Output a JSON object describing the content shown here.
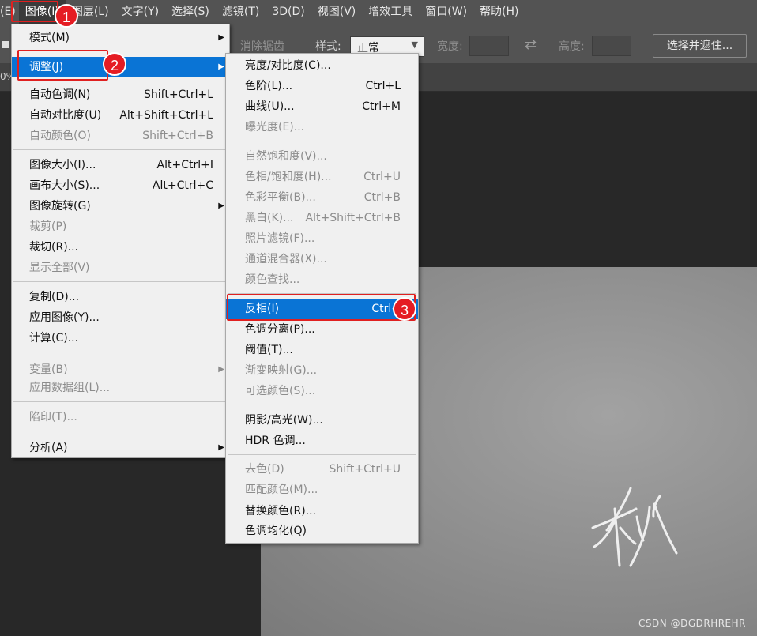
{
  "menubar": {
    "items": [
      "(E)",
      "图像(I)",
      "图层(L)",
      "文字(Y)",
      "选择(S)",
      "滤镜(T)",
      "3D(D)",
      "视图(V)",
      "增效工具",
      "窗口(W)",
      "帮助(H)"
    ]
  },
  "options": {
    "antialias": "消除锯齿",
    "style_label": "样式:",
    "style_value": "正常",
    "width_label": "宽度:",
    "height_label": "高度:",
    "select_mask_button": "选择并遮住...",
    "swap_icon": "swap-arrows-icon"
  },
  "tabstrip": {
    "zoom_fragment": "0%"
  },
  "image_menu": {
    "items": [
      {
        "label": "模式(M)",
        "shortcut": "",
        "submenu": true,
        "disabled": false
      },
      {
        "label": "调整(J)",
        "shortcut": "",
        "submenu": true,
        "disabled": false,
        "highlighted": true
      },
      {
        "label": "自动色调(N)",
        "shortcut": "Shift+Ctrl+L",
        "disabled": false
      },
      {
        "label": "自动对比度(U)",
        "shortcut": "Alt+Shift+Ctrl+L",
        "disabled": false
      },
      {
        "label": "自动颜色(O)",
        "shortcut": "Shift+Ctrl+B",
        "disabled": true
      },
      {
        "label": "图像大小(I)...",
        "shortcut": "Alt+Ctrl+I",
        "disabled": false
      },
      {
        "label": "画布大小(S)...",
        "shortcut": "Alt+Ctrl+C",
        "disabled": false
      },
      {
        "label": "图像旋转(G)",
        "shortcut": "",
        "submenu": true,
        "disabled": false
      },
      {
        "label": "裁剪(P)",
        "shortcut": "",
        "disabled": true
      },
      {
        "label": "裁切(R)...",
        "shortcut": "",
        "disabled": false
      },
      {
        "label": "显示全部(V)",
        "shortcut": "",
        "disabled": true
      },
      {
        "label": "复制(D)...",
        "shortcut": "",
        "disabled": false
      },
      {
        "label": "应用图像(Y)...",
        "shortcut": "",
        "disabled": false
      },
      {
        "label": "计算(C)...",
        "shortcut": "",
        "disabled": false
      },
      {
        "label": "变量(B)",
        "shortcut": "",
        "submenu": true,
        "disabled": true
      },
      {
        "label": "应用数据组(L)...",
        "shortcut": "",
        "disabled": true
      },
      {
        "label": "陷印(T)...",
        "shortcut": "",
        "disabled": true
      },
      {
        "label": "分析(A)",
        "shortcut": "",
        "submenu": true,
        "disabled": false
      }
    ]
  },
  "adjust_menu": {
    "items": [
      {
        "label": "亮度/对比度(C)...",
        "shortcut": "",
        "disabled": false
      },
      {
        "label": "色阶(L)...",
        "shortcut": "Ctrl+L",
        "disabled": false
      },
      {
        "label": "曲线(U)...",
        "shortcut": "Ctrl+M",
        "disabled": false
      },
      {
        "label": "曝光度(E)...",
        "shortcut": "",
        "disabled": true
      },
      {
        "label": "自然饱和度(V)...",
        "shortcut": "",
        "disabled": true
      },
      {
        "label": "色相/饱和度(H)...",
        "shortcut": "Ctrl+U",
        "disabled": true
      },
      {
        "label": "色彩平衡(B)...",
        "shortcut": "Ctrl+B",
        "disabled": true
      },
      {
        "label": "黑白(K)...",
        "shortcut": "Alt+Shift+Ctrl+B",
        "disabled": true
      },
      {
        "label": "照片滤镜(F)...",
        "shortcut": "",
        "disabled": true
      },
      {
        "label": "通道混合器(X)...",
        "shortcut": "",
        "disabled": true
      },
      {
        "label": "颜色查找...",
        "shortcut": "",
        "disabled": true
      },
      {
        "label": "反相(I)",
        "shortcut": "Ctrl+",
        "disabled": false,
        "highlighted": true
      },
      {
        "label": "色调分离(P)...",
        "shortcut": "",
        "disabled": false
      },
      {
        "label": "阈值(T)...",
        "shortcut": "",
        "disabled": false
      },
      {
        "label": "渐变映射(G)...",
        "shortcut": "",
        "disabled": true
      },
      {
        "label": "可选颜色(S)...",
        "shortcut": "",
        "disabled": true
      },
      {
        "label": "阴影/高光(W)...",
        "shortcut": "",
        "disabled": false
      },
      {
        "label": "HDR 色调...",
        "shortcut": "",
        "disabled": false
      },
      {
        "label": "去色(D)",
        "shortcut": "Shift+Ctrl+U",
        "disabled": true
      },
      {
        "label": "匹配颜色(M)...",
        "shortcut": "",
        "disabled": true
      },
      {
        "label": "替换颜色(R)...",
        "shortcut": "",
        "disabled": false
      },
      {
        "label": "色调均化(Q)",
        "shortcut": "",
        "disabled": false
      }
    ]
  },
  "annotations": {
    "badge1": "1",
    "badge2": "2",
    "badge3": "3"
  },
  "watermark": "CSDN @DGDRHREHR",
  "colors": {
    "highlight": "#0a74d5",
    "annotation_red": "#e02020",
    "menubar": "#535353"
  }
}
